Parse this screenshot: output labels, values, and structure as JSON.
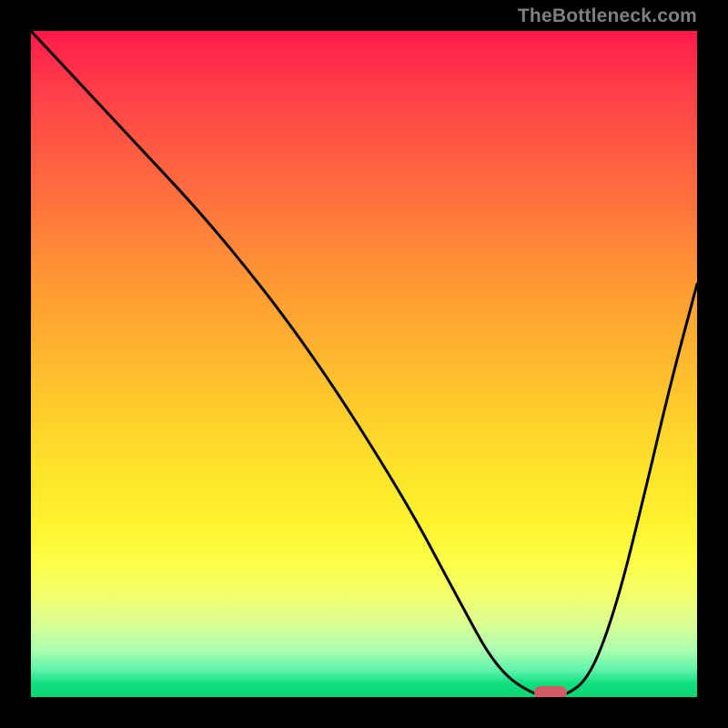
{
  "watermark": "TheBottleneck.com",
  "chart_data": {
    "type": "line",
    "title": "",
    "xlabel": "",
    "ylabel": "",
    "xlim": [
      0,
      100
    ],
    "ylim": [
      0,
      100
    ],
    "background_gradient": {
      "top": "#ff1a4b",
      "bottom": "#0ad674"
    },
    "series": [
      {
        "name": "bottleneck-curve",
        "x": [
          0,
          14,
          28,
          42,
          56,
          64,
          70,
          76,
          80,
          84,
          88,
          92,
          96,
          100
        ],
        "values": [
          100,
          85,
          70,
          52,
          30,
          15,
          4,
          0,
          0,
          3,
          14,
          30,
          47,
          62
        ]
      }
    ],
    "marker": {
      "name": "optimal-point",
      "x": 78,
      "y": 0,
      "width_pct": 5,
      "color": "#d35b63"
    }
  }
}
